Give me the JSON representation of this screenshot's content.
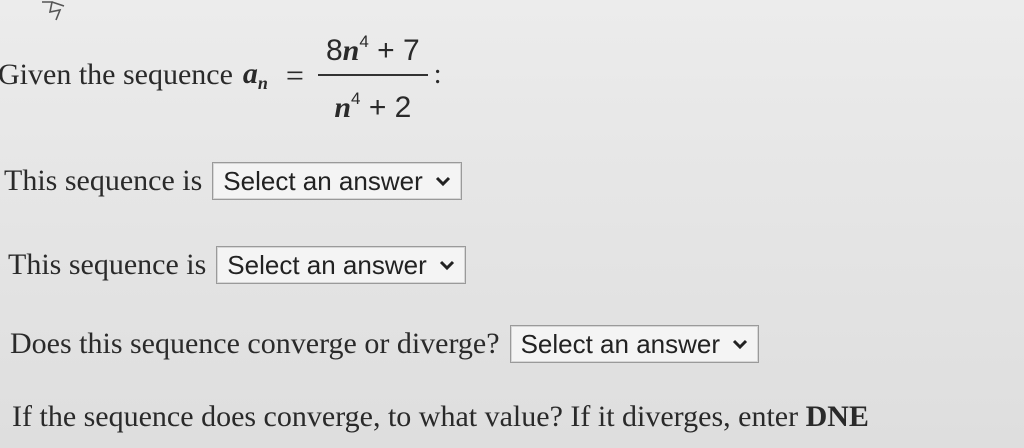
{
  "question": {
    "prefix": "Given the sequence",
    "variable": "a",
    "subscript": "n",
    "equals": "=",
    "numerator": {
      "coef": "8",
      "var": "n",
      "exp": "4",
      "rest": "+ 7"
    },
    "denominator": {
      "var": "n",
      "exp": "4",
      "rest": "+ 2"
    },
    "suffix": ":"
  },
  "rows": [
    {
      "label": "This sequence is",
      "select": "Select an answer"
    },
    {
      "label": "This sequence is",
      "select": "Select an answer"
    },
    {
      "label": "Does this sequence converge or diverge?",
      "select": "Select an answer"
    }
  ],
  "final_question": {
    "text": "If the sequence does converge, to what value? If it diverges, enter",
    "emphasis": "DNE"
  },
  "icons": [
    "cursor-icon",
    "chevron-down-icon"
  ]
}
